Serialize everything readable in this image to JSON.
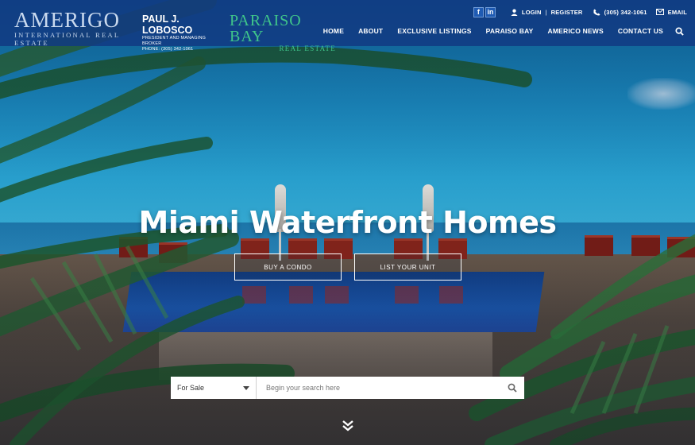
{
  "header": {
    "brand": {
      "name": "AMERIGO",
      "tagline": "INTERNATIONAL REAL ESTATE"
    },
    "broker": {
      "name": "PAUL J. LOBOSCO",
      "title": "PRESIDENT AND MANAGING BROKER",
      "phone": "PHONE: (305) 342-1061"
    },
    "partner": {
      "name": "PARAISO BAY",
      "sub": "REAL ESTATE"
    },
    "social": [
      {
        "label": "f",
        "icon": "facebook-icon"
      },
      {
        "label": "in",
        "icon": "linkedin-icon"
      }
    ],
    "topbar": {
      "login": "LOGIN",
      "register": "REGISTER",
      "phone": "(305) 342-1061",
      "email": "EMAIL"
    },
    "nav": [
      "HOME",
      "ABOUT",
      "EXCLUSIVE LISTINGS",
      "PARAISO BAY",
      "AMERICO NEWS",
      "CONTACT US"
    ]
  },
  "hero": {
    "title": "Miami Waterfront Homes",
    "buttons": {
      "buy": "BUY A CONDO",
      "list": "LIST YOUR UNIT"
    }
  },
  "search": {
    "mode": "For Sale",
    "placeholder": "Begin your search here"
  },
  "colors": {
    "header": "#123a82",
    "accent_green": "#3fc58a",
    "white": "#ffffff"
  }
}
